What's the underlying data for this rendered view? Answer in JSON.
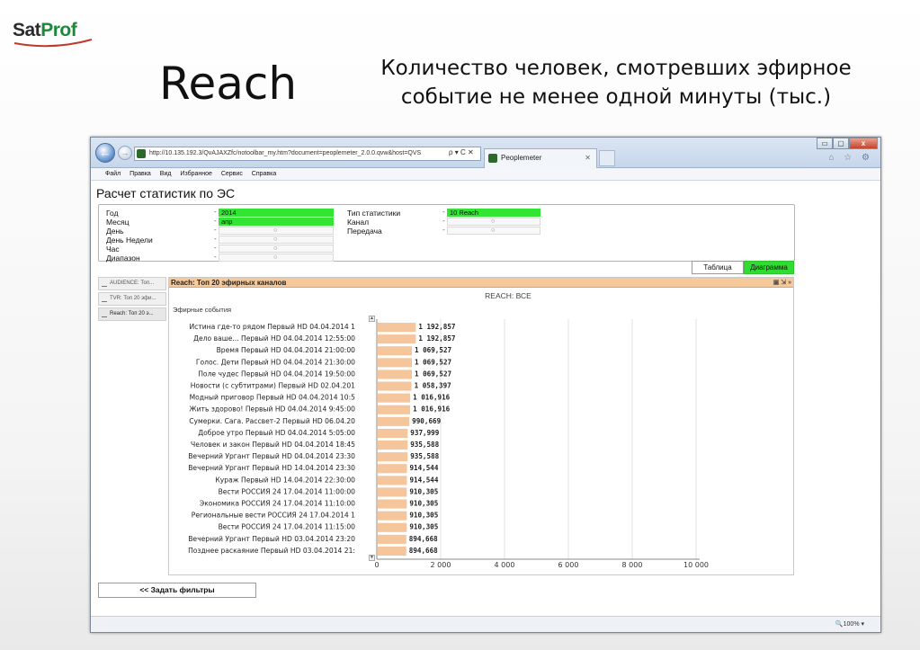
{
  "slide": {
    "logo_sat": "Sat",
    "logo_prof": "Prof",
    "title": "Reach",
    "subtitle": "Количество человек, смотревших эфирное событие не менее одной минуты (тыс.)"
  },
  "browser": {
    "url": "http://10.135.192.3/QvAJAXZfc/notoolbar_my.htm?document=peoplemeter_2.0.0.qvw&host=QVS",
    "address_controls": "ρ ▾ C ✕",
    "tab_title": "Peoplemeter",
    "tab_close": "✕",
    "back_glyph": "←",
    "forward_glyph": "→",
    "window_buttons": [
      "▭",
      "▢",
      "x"
    ],
    "tool_icons": "⌂ ☆ ⚙",
    "menu": [
      "Файл",
      "Правка",
      "Вид",
      "Избранное",
      "Сервис",
      "Справка"
    ],
    "zoom": "🔍100%  ▾"
  },
  "page": {
    "heading": "Расчет статистик по ЭС",
    "filters_left": [
      {
        "label": "Год",
        "value": "2014",
        "selected": true
      },
      {
        "label": "Месяц",
        "value": "апр",
        "selected": true
      },
      {
        "label": "День",
        "value": "○",
        "selected": false
      },
      {
        "label": "День Недели",
        "value": "○",
        "selected": false
      },
      {
        "label": "Час",
        "value": "○",
        "selected": false
      },
      {
        "label": "Диапазон",
        "value": "○",
        "selected": false
      }
    ],
    "filters_right": [
      {
        "label": "Тип статистики",
        "value": "10 Reach",
        "selected": true
      },
      {
        "label": "Канал",
        "value": "○",
        "selected": false
      },
      {
        "label": "Передача",
        "value": "○",
        "selected": false
      }
    ],
    "dash": "-",
    "btn_table": "Таблица",
    "btn_chart": "Диаграмма",
    "side_tabs": [
      "AUDIENCE: Топ...",
      "TVR: Топ 20 эфи...",
      "Reach: Топ 20 э..."
    ],
    "panel_title": "Reach: Топ 20 эфирных каналов",
    "panel_icons": "▣ ⇲ »",
    "filters_button": "<< Задать фильтры"
  },
  "colors": {
    "bar": "#f5c59b",
    "green": "#33e533",
    "panel_header": "#f6c99a"
  },
  "chart_data": {
    "type": "bar",
    "orientation": "horizontal",
    "title": "REACH: ВСЕ",
    "series_label": "Эфирные события",
    "categories": [
      "Истина где-то рядом Первый HD 04.04.2014 1",
      "Дело ваше... Первый HD 04.04.2014 12:55:00",
      "Время Первый HD 04.04.2014 21:00:00",
      "Голос. Дети Первый HD 04.04.2014 21:30:00",
      "Поле чудес Первый HD 04.04.2014 19:50:00",
      "Новости (с субтитрами) Первый HD 02.04.201",
      "Модный приговор Первый HD 04.04.2014 10:5",
      "Жить здорово! Первый HD 04.04.2014 9:45:00",
      "Сумерки. Сага. Рассвет-2 Первый HD 06.04.20",
      "Доброе утро Первый HD 04.04.2014 5:05:00",
      "Человек и закон Первый HD 04.04.2014 18:45",
      "Вечерний Ургант Первый HD 04.04.2014 23:30",
      "Вечерний Ургант Первый HD 14.04.2014 23:30",
      "Кураж Первый HD 14.04.2014 22:30:00",
      "Вести РОССИЯ 24 17.04.2014 11:00:00",
      "Экономика РОССИЯ 24 17.04.2014 11:10:00",
      "Региональные вести РОССИЯ 24 17.04.2014 1",
      "Вести РОССИЯ 24 17.04.2014 11:15:00",
      "Вечерний Ургант Первый HD 03.04.2014 23:20",
      "Позднее раскаяние Первый HD 03.04.2014 21:"
    ],
    "values": [
      1192.857,
      1192.857,
      1069.527,
      1069.527,
      1069.527,
      1058.397,
      1016.916,
      1016.916,
      990.669,
      937.999,
      935.588,
      935.588,
      914.544,
      914.544,
      910.305,
      910.305,
      910.305,
      910.305,
      894.668,
      894.668
    ],
    "value_labels": [
      "1 192,857",
      "1 192,857",
      "1 069,527",
      "1 069,527",
      "1 069,527",
      "1 058,397",
      "1 016,916",
      "1 016,916",
      "990,669",
      "937,999",
      "935,588",
      "935,588",
      "914,544",
      "914,544",
      "910,305",
      "910,305",
      "910,305",
      "910,305",
      "894,668",
      "894,668"
    ],
    "xticks": [
      0,
      2000,
      4000,
      6000,
      8000,
      10000
    ],
    "xtick_labels": [
      "0",
      "2 000",
      "4 000",
      "6 000",
      "8 000",
      "10 000"
    ],
    "xlim": [
      0,
      10000
    ],
    "grid": true
  }
}
